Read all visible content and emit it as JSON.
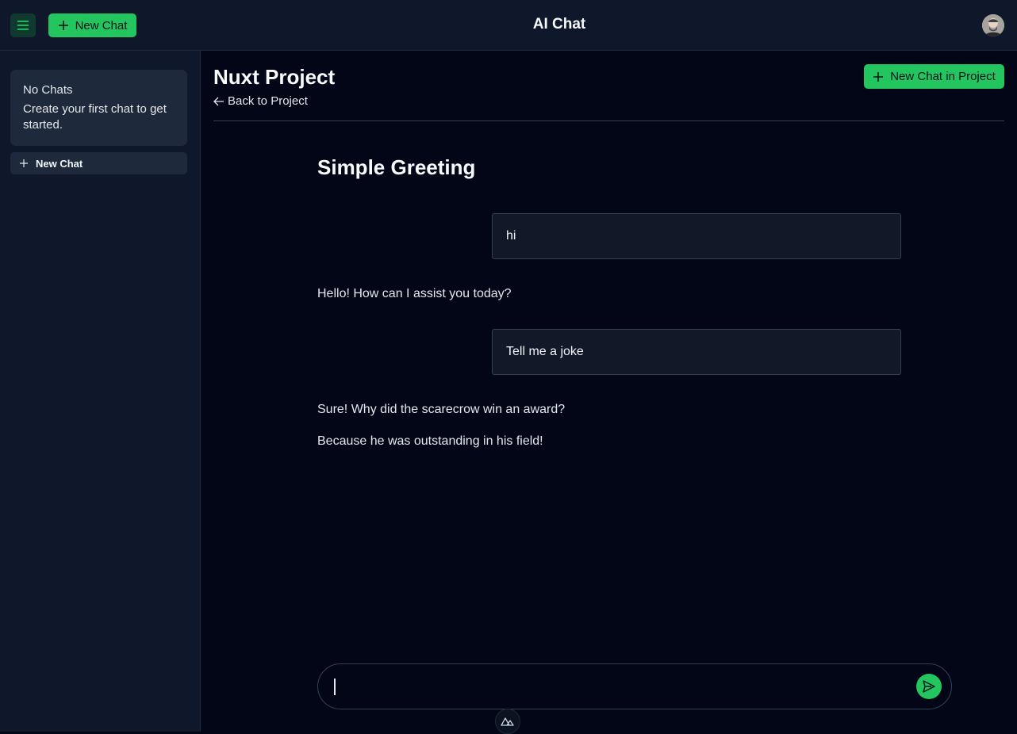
{
  "header": {
    "new_chat_label": "New Chat",
    "app_title": "AI Chat"
  },
  "sidebar": {
    "empty_title": "No Chats",
    "empty_message": "Create your first chat to get started.",
    "new_chat_label": "New Chat"
  },
  "project": {
    "title": "Nuxt Project",
    "back_label": "Back to Project",
    "new_chat_in_project_label": "New Chat in Project"
  },
  "chat": {
    "title": "Simple Greeting",
    "messages": [
      {
        "role": "user",
        "text": "hi"
      },
      {
        "role": "assistant",
        "lines": [
          "Hello! How can I assist you today?"
        ]
      },
      {
        "role": "user",
        "text": "Tell me a joke"
      },
      {
        "role": "assistant",
        "lines": [
          "Sure! Why did the scarecrow win an award?",
          "Because he was outstanding in his field!"
        ]
      }
    ]
  },
  "composer": {
    "value": "",
    "placeholder": ""
  },
  "colors": {
    "accent": "#22c55e",
    "background": "#020617",
    "surface": "#0f172a"
  },
  "icons": [
    "menu-icon",
    "plus-icon",
    "arrow-left-icon",
    "send-icon",
    "nuxt-logo-icon"
  ]
}
